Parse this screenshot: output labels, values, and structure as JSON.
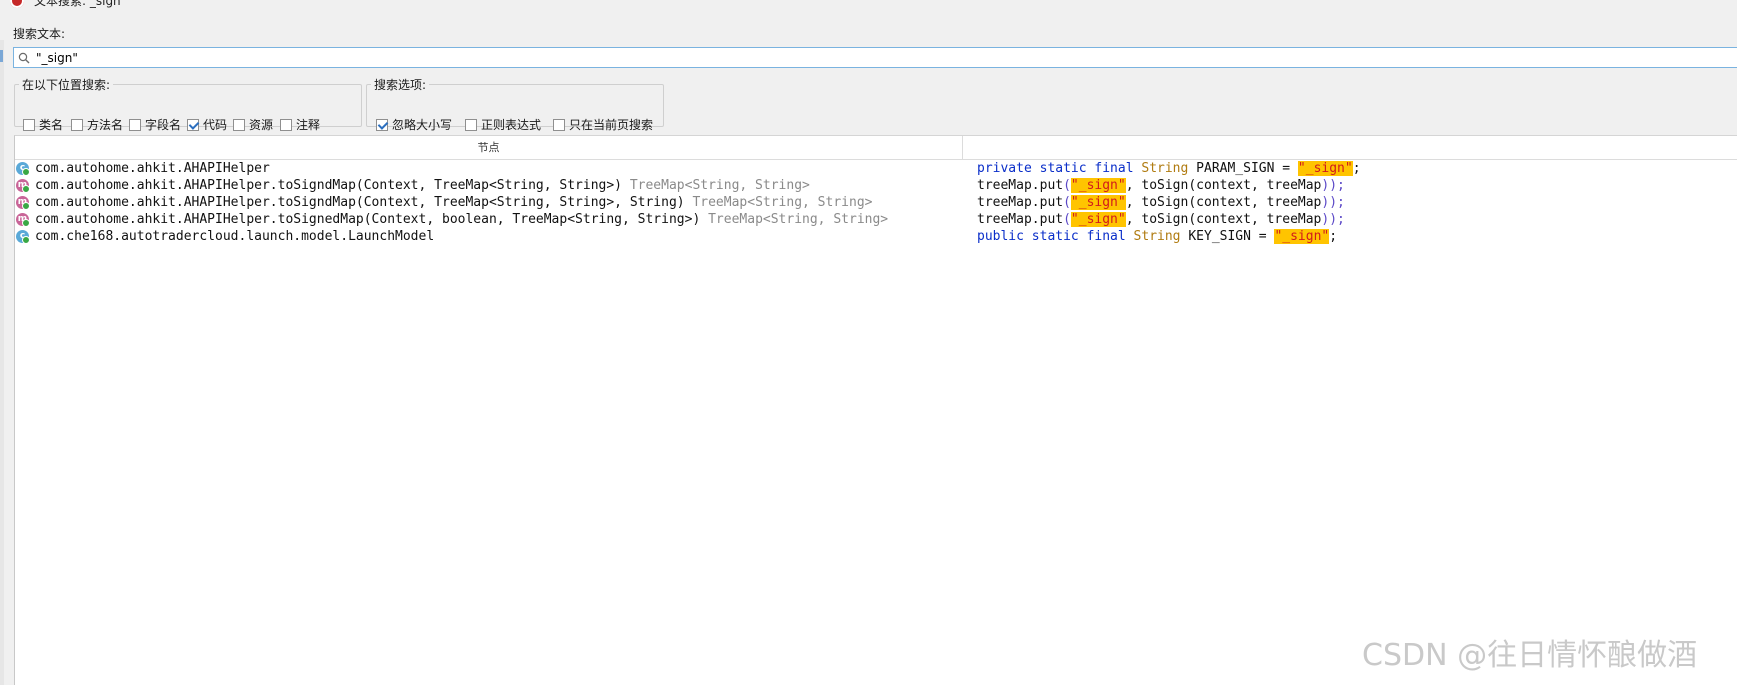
{
  "window": {
    "title": "文本搜索: _sign"
  },
  "search": {
    "label": "搜索文本:",
    "value": "\"_sign\"",
    "icon": "search-icon"
  },
  "location_group": {
    "legend": "在以下位置搜索:",
    "options": [
      {
        "label": "类名",
        "checked": false
      },
      {
        "label": "方法名",
        "checked": false
      },
      {
        "label": "字段名",
        "checked": false
      },
      {
        "label": "代码",
        "checked": true
      },
      {
        "label": "资源",
        "checked": false
      },
      {
        "label": "注释",
        "checked": false
      }
    ]
  },
  "options_group": {
    "legend": "搜索选项:",
    "options": [
      {
        "label": "忽略大小写",
        "checked": true
      },
      {
        "label": "正则表达式",
        "checked": false
      },
      {
        "label": "只在当前页搜索",
        "checked": false
      }
    ]
  },
  "table": {
    "column_node": "节点",
    "column_code": "",
    "rows": [
      {
        "icon": "class-icon",
        "node": "com.autohome.ahkit.AHAPIHelper",
        "ret": "",
        "code": {
          "p1": "private static final",
          "p2": "String",
          "p3": " PARAM_SIGN = ",
          "hl": "\"_sign\"",
          "p4": ";"
        }
      },
      {
        "icon": "method-icon",
        "node": "com.autohome.ahkit.AHAPIHelper.toSigndMap(Context, TreeMap<String, String>)",
        "ret": "TreeMap<String, String>",
        "code": {
          "p1": "treeMap.put",
          "p2": "(",
          "hl": "\"_sign\"",
          "p3": ", toSign(context, treeMap",
          "p4": "));"
        }
      },
      {
        "icon": "method-icon",
        "node": "com.autohome.ahkit.AHAPIHelper.toSigndMap(Context, TreeMap<String, String>, String)",
        "ret": "TreeMap<String, String>",
        "code": {
          "p1": "treeMap.put",
          "p2": "(",
          "hl": "\"_sign\"",
          "p3": ", toSign(context, treeMap",
          "p4": "));"
        }
      },
      {
        "icon": "method-icon",
        "node": "com.autohome.ahkit.AHAPIHelper.toSignedMap(Context, boolean, TreeMap<String, String>)",
        "ret": "TreeMap<String, String>",
        "code": {
          "p1": "treeMap.put",
          "p2": "(",
          "hl": "\"_sign\"",
          "p3": ", toSign(context, treeMap",
          "p4": "));"
        }
      },
      {
        "icon": "class-icon",
        "node": "com.che168.autotradercloud.launch.model.LaunchModel",
        "ret": "",
        "code": {
          "p1": "public static final",
          "p2": "String",
          "p3": " KEY_SIGN = ",
          "hl": "\"_sign\"",
          "p4": ";"
        }
      }
    ]
  },
  "watermark": "CSDN @往日情怀酿做酒",
  "colors": {
    "highlight": "#ffc400",
    "keyword": "#0a2ec9",
    "type": "#b07b10",
    "accent": "#7ab3e0"
  }
}
